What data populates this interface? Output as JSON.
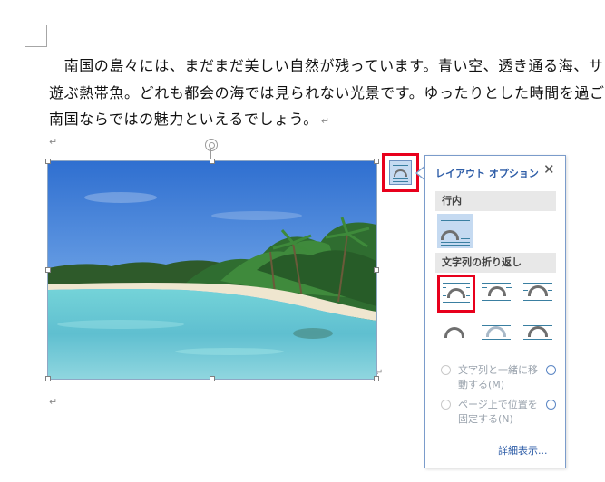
{
  "document": {
    "lines": [
      "　南国の島々には、まだまだ美しい自然が残っています。青い空、透き通る海、サ",
      "遊ぶ熱帯魚。どれも都会の海では見られない光景です。ゆったりとした時間を過ご",
      "南国ならではの魅力といえるでしょう。"
    ],
    "paragraph_mark": "↵"
  },
  "layout_options": {
    "title": "レイアウト オプション",
    "close": "✕",
    "section_inline": "行内",
    "section_wrap": "文字列の折り返し",
    "options": [
      {
        "option": "move-with-text",
        "label": "文字列と一緒に移動する(M)"
      },
      {
        "option": "fix-position",
        "label": "ページ上で位置を固定する(N)"
      }
    ],
    "info_icon": "i",
    "more_link": "詳細表示..."
  },
  "colors": {
    "highlight": "#e8001c",
    "accent": "#2f5ea8",
    "selected": "#c5daf1"
  },
  "icons": [
    "layout-options-icon",
    "close-icon",
    "rotate-handle-icon",
    "info-icon"
  ]
}
